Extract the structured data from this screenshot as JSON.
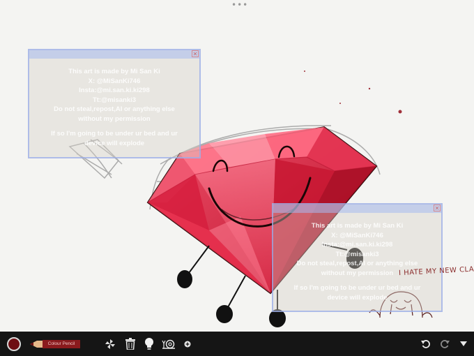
{
  "toolbar": {
    "pencil_label": "Colour Pencil",
    "active_color": "#6e0d12"
  },
  "watermark": {
    "lines": [
      "This art is made by Mi San Ki",
      "X: @MiSanKi746",
      "Insta:@mi.san.ki.ki298",
      "Tt:@misanki3",
      "Do not steal,repost,AI or anything else",
      "without my permission",
      "",
      "If so I'm going to be under ur bed and ur",
      "device will explode"
    ]
  },
  "handwriting": "I HATE MY NEW CLASS",
  "icons": [
    "grip-dots-icon",
    "color-swatch-icon",
    "pencil-tool-icon",
    "pinwheel-icon",
    "trash-icon",
    "lightbulb-icon",
    "snail-icon",
    "add-icon",
    "undo-icon",
    "redo-icon",
    "caret-down-icon",
    "close-icon"
  ]
}
